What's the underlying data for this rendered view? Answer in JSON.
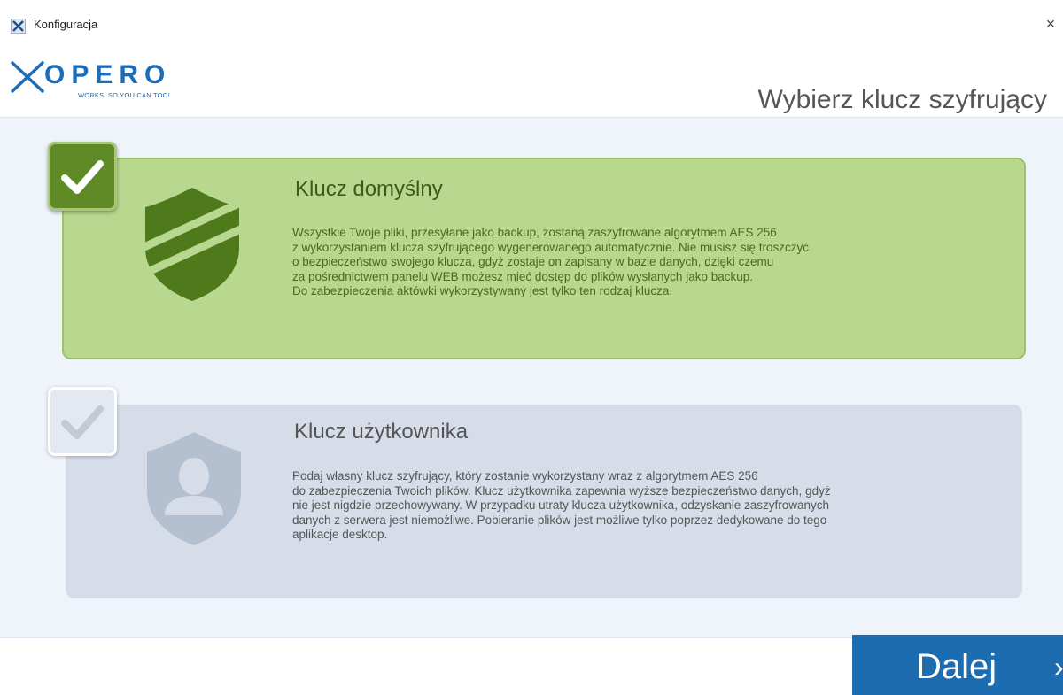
{
  "window": {
    "title": "Konfiguracja",
    "close_glyph": "×"
  },
  "brand": {
    "name": "OPERO",
    "tagline": "WORKS, SO YOU CAN TOO!",
    "color": "#1d6cb8"
  },
  "header": {
    "title": "Wybierz klucz szyfrujący"
  },
  "options": [
    {
      "id": "default",
      "selected": true,
      "title": "Klucz domyślny",
      "description": "Wszystkie Twoje pliki, przesyłane jako backup, zostaną zaszyfrowane algorytmem AES 256\nz wykorzystaniem klucza szyfrującego wygenerowanego automatycznie. Nie musisz się troszczyć\no bezpieczeństwo swojego klucza, gdyż zostaje on zapisany w bazie danych, dzięki czemu\nza pośrednictwem panelu WEB możesz mieć dostęp do plików wysłanych jako backup.\nDo zabezpieczenia aktówki wykorzystywany jest tylko ten rodzaj klucza.",
      "icon": "shield-icon",
      "color": "#b9d88f"
    },
    {
      "id": "user",
      "selected": false,
      "title": "Klucz użytkownika",
      "description": "Podaj własny klucz szyfrujący, który zostanie wykorzystany wraz z algorytmem AES 256\ndo zabezpieczenia Twoich plików. Klucz użytkownika zapewnia wyższe bezpieczeństwo danych, gdyż\nnie jest nigdzie przechowywany. W przypadku utraty klucza użytkownika, odzyskanie zaszyfrowanych\ndanych z serwera jest niemożliwe. Pobieranie plików jest możliwe tylko poprzez dedykowane do tego\naplikacje desktop.",
      "icon": "user-shield-icon",
      "color": "#d6dde9"
    }
  ],
  "footer": {
    "next_label": "Dalej",
    "next_arrow": "›",
    "button_color": "#1d6cb0"
  }
}
